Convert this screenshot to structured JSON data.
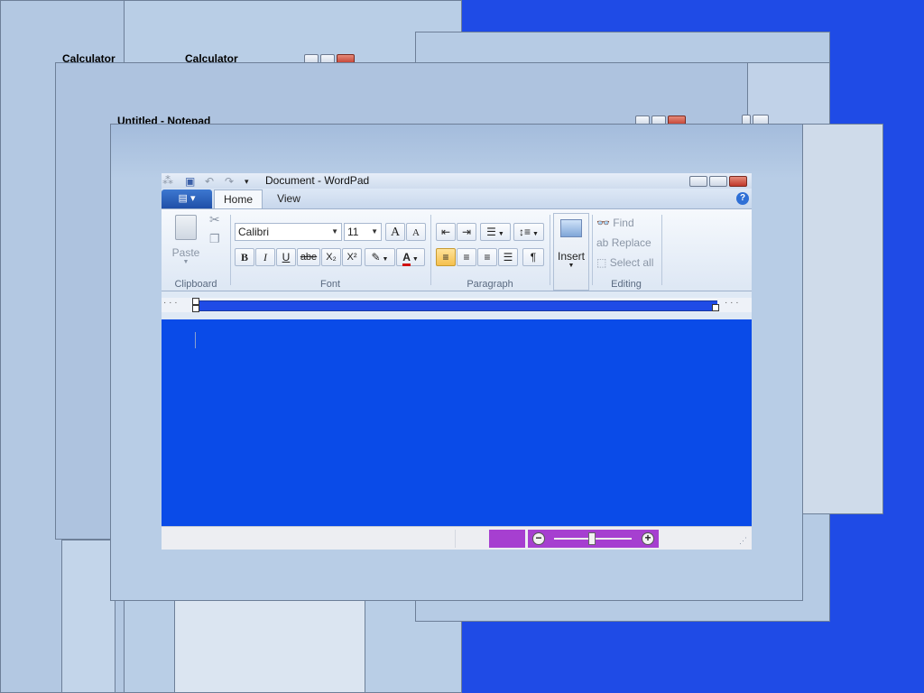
{
  "background_windows": {
    "calculator_1_title": "Calculator",
    "calculator_2_title": "Calculator",
    "notepad_title": "Untitled - Notepad"
  },
  "wordpad": {
    "title": "Document - WordPad",
    "tabs": {
      "home": "Home",
      "view": "View"
    },
    "help": "?",
    "clipboard": {
      "paste": "Paste",
      "label": "Clipboard"
    },
    "font": {
      "family": "Calibri",
      "size": "11",
      "label": "Font",
      "grow": "A",
      "shrink": "A",
      "bold": "B",
      "italic": "I",
      "underline": "U",
      "strike": "abe",
      "subscript": "X₂",
      "superscript": "X²"
    },
    "paragraph": {
      "label": "Paragraph"
    },
    "insert": {
      "label": "Insert"
    },
    "editing": {
      "find": "Find",
      "replace": "Replace",
      "select_all": "Select all",
      "label": "Editing"
    }
  },
  "colors": {
    "desktop": "#1f4be6",
    "document": "#0a4be8",
    "zoom_highlight": "#a63fd0"
  }
}
